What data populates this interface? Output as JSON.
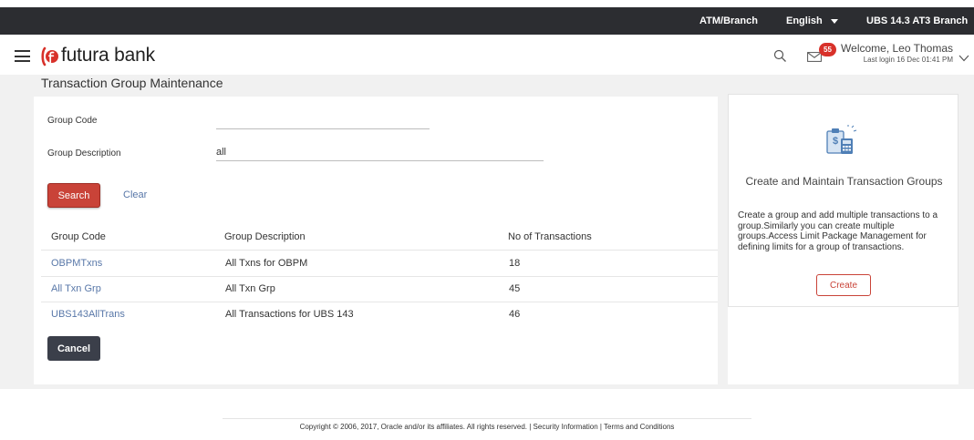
{
  "topbar": {
    "atm_branch": "ATM/Branch",
    "language": "English",
    "branch": "UBS 14.3 AT3 Branch"
  },
  "header": {
    "brand": "futura bank",
    "notification_count": "55",
    "welcome": "Welcome, Leo Thomas",
    "last_login": "Last login 16 Dec 01:41 PM"
  },
  "page": {
    "title": "Transaction Group Maintenance"
  },
  "form": {
    "group_code_label": "Group Code",
    "group_code_value": "",
    "group_description_label": "Group Description",
    "group_description_value": "all",
    "search_label": "Search",
    "clear_label": "Clear"
  },
  "table": {
    "columns": [
      "Group Code",
      "Group Description",
      "No of Transactions"
    ],
    "rows": [
      {
        "code": "OBPMTxns",
        "description": "All Txns for OBPM",
        "count": "18"
      },
      {
        "code": "All Txn Grp",
        "description": "All Txn Grp",
        "count": "45"
      },
      {
        "code": "UBS143AllTrans",
        "description": "All Transactions for UBS 143",
        "count": "46"
      }
    ]
  },
  "actions": {
    "cancel_label": "Cancel"
  },
  "side_panel": {
    "icon": "transaction-group-icon",
    "title": "Create and Maintain Transaction Groups",
    "description": "Create a group and add multiple transactions to a group.Similarly you can create multiple groups.Access Limit Package Management for defining limits for a group of transactions.",
    "create_label": "Create"
  },
  "footer": {
    "text": "Copyright © 2006, 2017, Oracle and/or its affiliates. All rights reserved. | Security Information | Terms and Conditions"
  },
  "colors": {
    "topbar": "#2c2d31",
    "primary_button": "#c94338",
    "cancel_button": "#3b3f4a",
    "link": "#5877a8",
    "badge": "#d8312a"
  }
}
